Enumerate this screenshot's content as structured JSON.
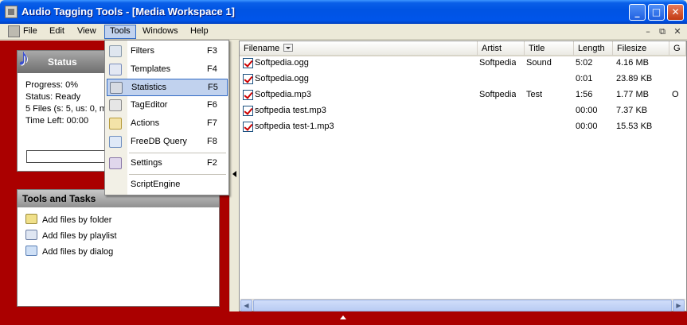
{
  "window": {
    "title": "Audio Tagging Tools - [Media Workspace 1]",
    "controls": {
      "minimize": "_",
      "maximize": "□",
      "close": "✕"
    }
  },
  "menubar": {
    "items": [
      "File",
      "Edit",
      "View",
      "Tools",
      "Windows",
      "Help"
    ],
    "mdi_controls": {
      "minimize": "–",
      "restore": "⧉",
      "close": "✕"
    }
  },
  "tools_menu": {
    "items": [
      {
        "label": "Filters",
        "shortcut": "F3",
        "icon": "filter-icon"
      },
      {
        "label": "Templates",
        "shortcut": "F4",
        "icon": "template-icon"
      },
      {
        "label": "Statistics",
        "shortcut": "F5",
        "icon": "statistics-icon"
      },
      {
        "label": "TagEditor",
        "shortcut": "F6",
        "icon": "tag-editor-icon"
      },
      {
        "label": "Actions",
        "shortcut": "F7",
        "icon": "actions-icon"
      },
      {
        "label": "FreeDB Query",
        "shortcut": "F8",
        "icon": "freedb-icon"
      },
      {
        "label": "Settings",
        "shortcut": "F2",
        "icon": "settings-icon"
      },
      {
        "label": "ScriptEngine",
        "shortcut": "",
        "icon": ""
      }
    ]
  },
  "status_panel": {
    "header": "Status",
    "progress": "Progress: 0%",
    "status": "Status: Ready",
    "files": "5 Files (s: 5, us: 0, m",
    "time_left": "Time Left: 00:00"
  },
  "tasks_panel": {
    "header": "Tools and Tasks",
    "items": [
      "Add files by folder",
      "Add files by playlist",
      "Add files by dialog"
    ]
  },
  "file_list": {
    "columns": [
      "Filename",
      "Artist",
      "Title",
      "Length",
      "Filesize",
      "G"
    ],
    "rows": [
      {
        "checked": true,
        "filename": "Softpedia.ogg",
        "artist": "Softpedia",
        "title": "Sound",
        "length": "5:02",
        "filesize": "4.16 MB",
        "extra": ""
      },
      {
        "checked": true,
        "filename": "Softpedia.ogg",
        "artist": "",
        "title": "",
        "length": "0:01",
        "filesize": "23.89 KB",
        "extra": ""
      },
      {
        "checked": true,
        "filename": "Softpedia.mp3",
        "artist": "Softpedia",
        "title": "Test",
        "length": "1:56",
        "filesize": "1.77 MB",
        "extra": "O"
      },
      {
        "checked": true,
        "filename": "softpedia test.mp3",
        "artist": "",
        "title": "",
        "length": "00:00",
        "filesize": "7.37 KB",
        "extra": ""
      },
      {
        "checked": true,
        "filename": "softpedia test-1.mp3",
        "artist": "",
        "title": "",
        "length": "00:00",
        "filesize": "15.53 KB",
        "extra": ""
      }
    ]
  },
  "colors": {
    "workspace_bg": "#aa0000",
    "titlebar": "#0054e3",
    "menu_highlight": "#c1d2ee"
  }
}
